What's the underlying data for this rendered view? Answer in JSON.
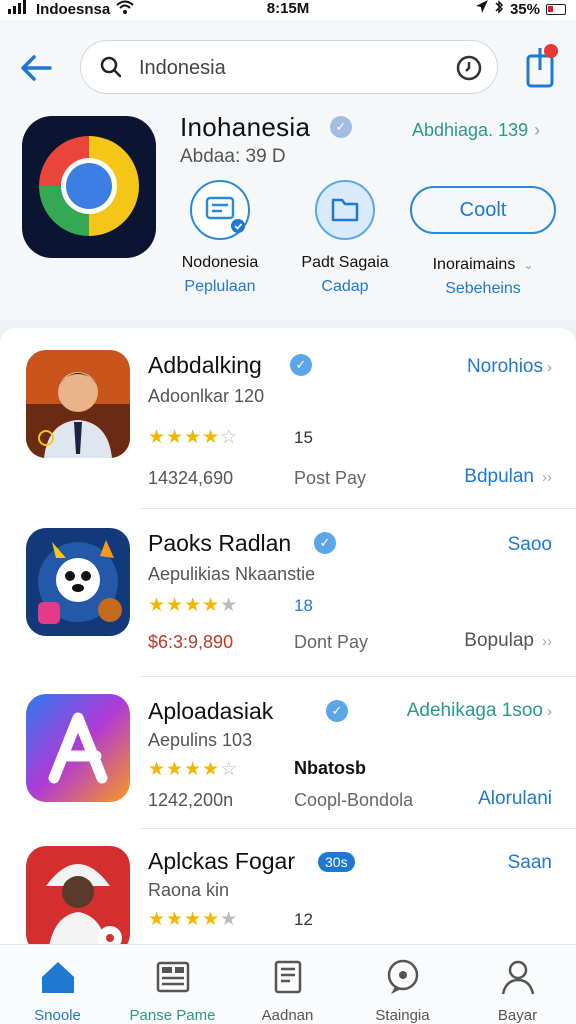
{
  "status": {
    "carrier": "Indoesnsa",
    "time": "8:15M",
    "battery": "35%"
  },
  "search": {
    "query": "Indonesia"
  },
  "app": {
    "title": "Inohanesia",
    "subtitle": "Abdaa: 39 D",
    "link": "Abdhiaga. 139",
    "actions": [
      {
        "label1": "Nodonesia",
        "label2": "Peplulaan"
      },
      {
        "label1": "Padt Sagaia",
        "label2": "Cadap"
      },
      {
        "label1": "Inoraimains",
        "label2": "Sebeheins",
        "button": "Coolt"
      }
    ]
  },
  "list": [
    {
      "name": "Adbdalking",
      "subtitle": "Adoonlkar 120",
      "count": "15",
      "price": "14324,690",
      "pay": "Post Pay",
      "action": "Norohios",
      "popular": "Bdpulan",
      "rating": 4.5
    },
    {
      "name": "Paoks Radlan",
      "subtitle": "Aepulikias Nkaanstie",
      "count": "18",
      "price": "$6:3:9,890",
      "pay": "Dont Pay",
      "action": "Saoo",
      "popular": "Bopulap",
      "rating": 4.0
    },
    {
      "name": "Aploadasiak",
      "subtitle": "Aepulins 103",
      "count": "",
      "price": "1242,200n",
      "pay": "Coopl-Bondola",
      "extra": "Nbatosb",
      "action": "Adehikaga 1soo",
      "popular": "Alorulani",
      "rating": 3.5
    },
    {
      "name": "Aplckas Fogar",
      "subtitle": "Raona kin",
      "tag": "30s",
      "count": "12",
      "action": "Saan",
      "rating": 4.0
    }
  ],
  "nav": [
    {
      "label": "Snoole",
      "icon": "home-icon"
    },
    {
      "label": "Panse Pame",
      "icon": "grid-icon"
    },
    {
      "label": "Aadnan",
      "icon": "document-icon"
    },
    {
      "label": "Staingia",
      "icon": "chat-icon"
    },
    {
      "label": "Bayar",
      "icon": "person-icon"
    }
  ],
  "colors": {
    "accent": "#1f78d1",
    "star": "#f2b705",
    "teal": "#279b8a"
  }
}
